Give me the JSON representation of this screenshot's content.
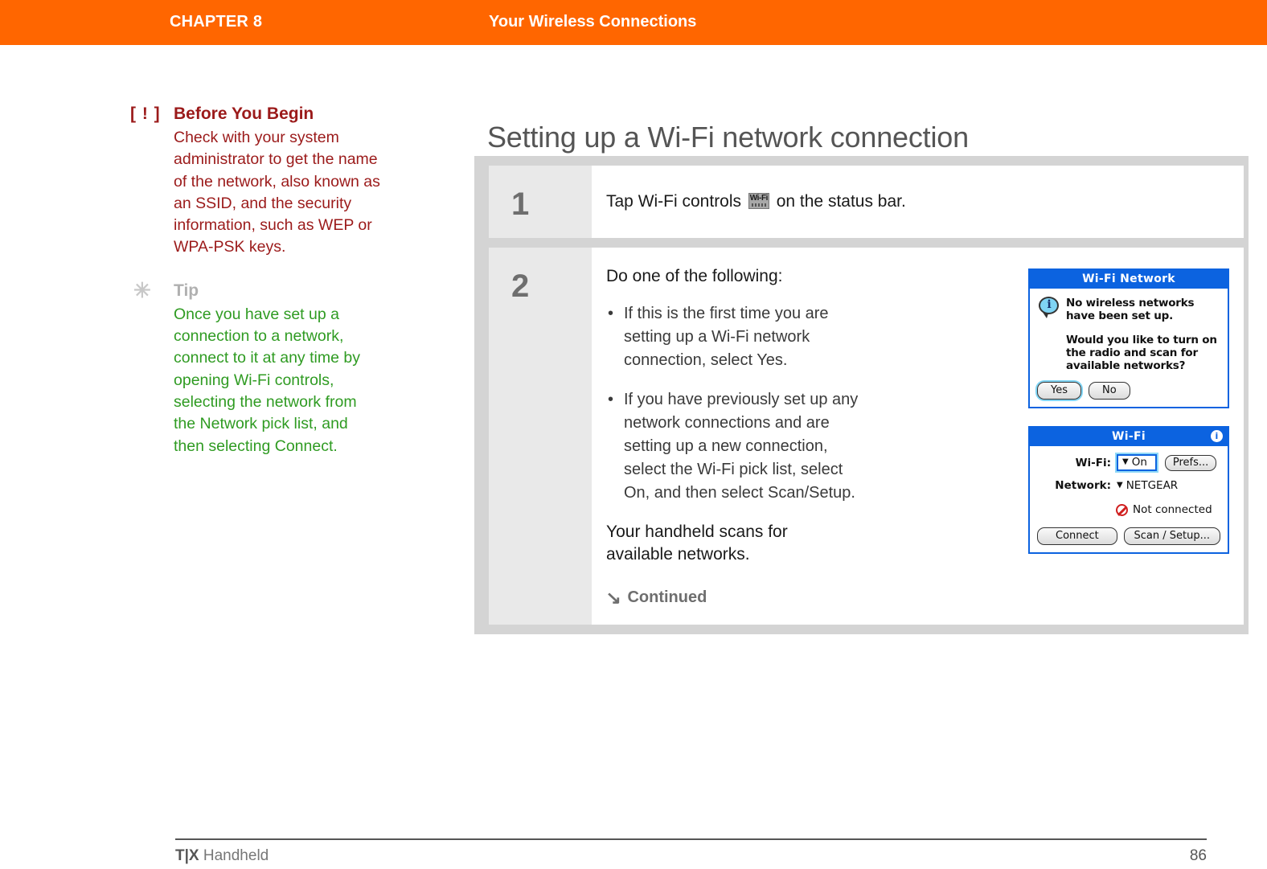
{
  "header": {
    "chapter_label": "CHAPTER 8",
    "chapter_title": "Your Wireless Connections",
    "bar_color": "#FF6600"
  },
  "sidebar": {
    "notes": [
      {
        "marker": "[ ! ]",
        "marker_icon": "warning-bracket-icon",
        "title": "Before You Begin",
        "body": "Check with your system administrator to get the name of the network, also known as an SSID, and the security information, such as WEP or WPA-PSK keys.",
        "color": "#9B1A1A"
      },
      {
        "marker": "✳",
        "marker_icon": "asterisk-icon",
        "title": "Tip",
        "body": "Once you have set up a connection to a network, connect to it at any time by opening Wi-Fi controls, selecting the network from the Network pick list, and then selecting Connect.",
        "color": "#2F9B22"
      }
    ]
  },
  "main": {
    "page_title": "Setting up a Wi-Fi network connection",
    "steps": [
      {
        "number": "1",
        "text_before_icon": "Tap Wi-Fi controls",
        "icon_label": "Wi-Fi",
        "icon_name": "wifi-status-bar-icon",
        "text_after_icon": "on the status bar."
      },
      {
        "number": "2",
        "intro": "Do one of the following:",
        "bullets": [
          "If this is the first time you are setting up a Wi-Fi network connection, select Yes.",
          "If you have previously set up any network connections and are setting up a new connection, select the Wi-Fi pick list, select On, and then select Scan/Setup."
        ],
        "scan_note": "Your handheld scans for available networks.",
        "continued_label": "Continued",
        "continued_arrow": "↘"
      }
    ]
  },
  "dialogs": [
    {
      "name": "wifi-network-alert",
      "title": "Wi-Fi Network",
      "icon": "info-bubble-icon",
      "message_1": "No wireless networks have been set up.",
      "message_2": "Would you like to turn on the radio and scan for available networks?",
      "buttons": [
        {
          "label": "Yes",
          "focused": true
        },
        {
          "label": "No",
          "focused": false
        }
      ],
      "title_bar_color": "#0C63E0"
    },
    {
      "name": "wifi-settings-dialog",
      "title": "Wi-Fi",
      "info_badge": "i",
      "fields": [
        {
          "label": "Wi-Fi:",
          "value": "On",
          "type": "picklist-boxed"
        },
        {
          "label": "Network:",
          "value": "NETGEAR",
          "type": "picklist"
        }
      ],
      "status": "Not connected",
      "status_icon": "not-connected-icon",
      "buttons": [
        {
          "label": "Connect"
        },
        {
          "label": "Scan / Setup..."
        }
      ],
      "prefs_button": "Prefs...",
      "title_bar_color": "#0C63E0"
    }
  ],
  "footer": {
    "brand_mark": "T|X",
    "brand_text": " Handheld",
    "page_number": "86"
  }
}
